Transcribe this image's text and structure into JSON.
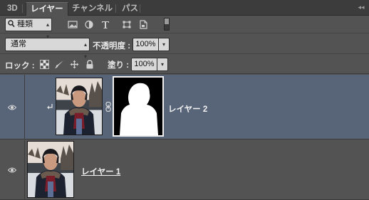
{
  "tabs": [
    {
      "label": "3D",
      "active": false
    },
    {
      "label": "レイヤー",
      "active": true
    },
    {
      "label": "チャンネル",
      "active": false
    },
    {
      "label": "パス",
      "active": false
    }
  ],
  "filter": {
    "kind_label": "種類",
    "icons": [
      "image-filter-icon",
      "adjustment-filter-icon",
      "type-filter-icon",
      "shape-filter-icon",
      "smart-object-filter-icon"
    ]
  },
  "blend": {
    "mode": "通常",
    "opacity_label": "不透明度 :",
    "opacity_value": "100%"
  },
  "lock": {
    "label": "ロック :",
    "fill_label": "塗り :",
    "fill_value": "100%"
  },
  "layers": [
    {
      "name": "レイヤー 2",
      "selected": true,
      "clipped": true,
      "has_mask": true
    },
    {
      "name": "レイヤー 1",
      "selected": false,
      "clipped": false,
      "has_mask": false
    }
  ],
  "colors": {
    "panel_bg": "#535353",
    "tab_bar": "#3c3c3c",
    "selected_layer": "#586478"
  }
}
